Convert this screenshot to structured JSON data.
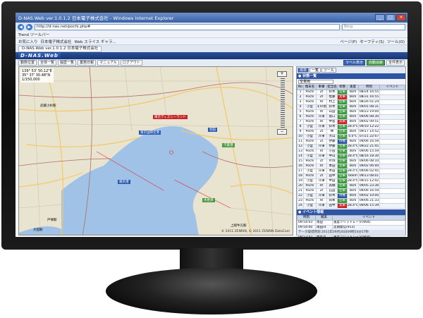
{
  "window": {
    "title": "D-NAS.Web ver.1.0.1.2 日本電子株式会社 - Windows Internet Explorer",
    "min": "_",
    "max": "□",
    "close": "×"
  },
  "address": {
    "url": "http://d-nas.net/pochi.php#",
    "search_placeholder": "Bing"
  },
  "toolbars": {
    "trend_label": "Trend ツールバー",
    "fav_items": [
      "お気に入り",
      "日本電子株式会社",
      "Web スライス ギャラ..."
    ],
    "cmd_items": [
      "ページ(P)",
      "セーフティ(S)",
      "ツール(O)"
    ],
    "tab_label": "D-NAS.Web ver.1.0.1.2 日本電子株式会社"
  },
  "app": {
    "logo": "D-NAS.Web",
    "buttons": [
      "動態位置",
      "全体一覧",
      "履歴一覧",
      "業務日報",
      "マニュアル",
      "ログアウト"
    ],
    "right_buttons": [
      "ラベル表示",
      "自動追跡",
      "全件表示"
    ]
  },
  "map": {
    "coord_lines": [
      "139° 53' 50.12\"E",
      "35° 37' 30.48\"N",
      "1/150,000"
    ],
    "copyright": "© 2011 ZENRIN, © 2011 ZENRIN DataCom",
    "labels": [
      {
        "text": "武蔵小杉駅",
        "cls": ""
      },
      {
        "text": "東京ディズニーランド",
        "cls": "lbl-red"
      },
      {
        "text": "東京国際空港",
        "cls": "lbl-blue"
      },
      {
        "text": "羽田",
        "cls": "lbl-blue"
      },
      {
        "text": "横浜港",
        "cls": "lbl-blue"
      },
      {
        "text": "千葉港",
        "cls": "lbl-green"
      },
      {
        "text": "木更津",
        "cls": "lbl-green"
      },
      {
        "text": "上総牛久駅",
        "cls": ""
      },
      {
        "text": "戸塚駅",
        "cls": ""
      },
      {
        "text": "大船駅",
        "cls": ""
      }
    ],
    "zoom_in": "+",
    "zoom_out": "−"
  },
  "panel": {
    "tabs": [
      "標準",
      "一覧",
      "ツール"
    ],
    "vehicle_header": "● 状態一覧",
    "filter": "全車両",
    "columns": [
      "No",
      "端末名",
      "車番",
      "担当名",
      "状態",
      "速度",
      "時刻",
      "イベント"
    ],
    "rows": [
      [
        "1",
        "Pochi",
        "2t",
        "鈴木",
        "空車",
        "0km",
        "08/24 16:55",
        ""
      ],
      [
        "2",
        "Pochi",
        "2t",
        "佐藤",
        "実車",
        "0km",
        "08/31 16:55",
        ""
      ],
      [
        "3",
        "Pochi",
        "4t",
        "村上",
        "空車",
        "0km",
        "08/26 01:24",
        ""
      ],
      [
        "4",
        "小型",
        "その他",
        "鈴木",
        "空車",
        "0km",
        "09/01 08:31",
        ""
      ],
      [
        "5",
        "Pochi",
        "4t",
        "山田",
        "空車",
        "0km",
        "09/23 19:00",
        ""
      ],
      [
        "6",
        "Pochi",
        "冷凍",
        "坂口",
        "空車",
        "0km",
        "09/06 08:30",
        ""
      ],
      [
        "7",
        "Pochi",
        "4t",
        "中島",
        "実車",
        "0km",
        "09/02 09:51",
        ""
      ],
      [
        "8",
        "小型",
        "冷凍",
        "鈴木",
        "空車",
        "28.4℃",
        "09/10 12:22",
        ""
      ],
      [
        "9",
        "Pochi",
        "2t",
        "林",
        "空車",
        "0km",
        "09/17 14:52",
        ""
      ],
      [
        "10",
        "小型",
        "冷凍",
        "大山",
        "空車",
        "0.0℃",
        "07/21 22:07",
        ""
      ],
      [
        "11",
        "Pochi",
        "2t",
        "伊藤",
        "待機",
        "0km",
        "09/06 16:59",
        ""
      ],
      [
        "12",
        "小型",
        "冷凍",
        "伊藤",
        "空車",
        "28.4℃",
        "09/22 21:45",
        ""
      ],
      [
        "13",
        "Pochi",
        "4t",
        "小田",
        "空車",
        "0km",
        "09/06 15:59",
        ""
      ],
      [
        "14",
        "小型",
        "冷凍",
        "中山",
        "空車",
        "28.4℃",
        "08/16 18:30",
        ""
      ],
      [
        "15",
        "Pochi",
        "2t",
        "片岡",
        "空車",
        "0km",
        "09/06 08:10",
        ""
      ],
      [
        "16",
        "Pochi",
        "4t",
        "本田",
        "空車",
        "0km",
        "09/02 06:00",
        ""
      ],
      [
        "17",
        "小型",
        "冷凍",
        "木田",
        "空車",
        "28.4℃",
        "09/06 02:45",
        ""
      ],
      [
        "18",
        "Pochi",
        "2t",
        "田中",
        "空車",
        "66km",
        "09/13 08:01",
        ""
      ],
      [
        "19",
        "小型",
        "冷凍",
        "中田",
        "空車",
        "28.4℃",
        "09/15 12:42",
        ""
      ],
      [
        "20",
        "Pochi",
        "4t",
        "高橋",
        "空車",
        "0km",
        "09/05 23:36",
        ""
      ],
      [
        "21",
        "Pochi",
        "2t",
        "石田",
        "空車",
        "0km",
        "09/06 16:59",
        ""
      ],
      [
        "22",
        "小型",
        "冷凍",
        "鈴木",
        "待機",
        "0km",
        "09/02 10:00",
        ""
      ],
      [
        "23",
        "Pochi",
        "4t",
        "岡本",
        "空車",
        "0km",
        "09/06 21:33",
        ""
      ],
      [
        "24",
        "小型",
        "冷凍",
        "田中",
        "実車",
        "28.4℃",
        "09/06 15:39",
        ""
      ]
    ],
    "event_header": "● イベント情報",
    "event_columns": [
      "時刻",
      "端末",
      "イベント"
    ],
    "events": [
      [
        "09:54:03",
        "南田",
        "速度ソリットレータ(904)"
      ],
      [
        "09:54:00",
        "南田(4",
        "定期発信(913)"
      ],
      [
        "09:53:55",
        "大西A",
        "速度ソリットレータ(913)"
      ],
      [
        "09:53:42",
        "福島市",
        "速度ソリットレータ(904)"
      ],
      [
        "09:53:40",
        "大内",
        "定期発信(902)"
      ],
      [
        "09:53:23",
        "中山(6",
        "定期発信(904)"
      ]
    ],
    "status": "データ取得時刻 2011年09月26日09時54分57秒"
  },
  "colors": {
    "state_empty": "#3d9a3d",
    "state_busy": "#c8262b",
    "state_wait": "#2d55a3"
  }
}
